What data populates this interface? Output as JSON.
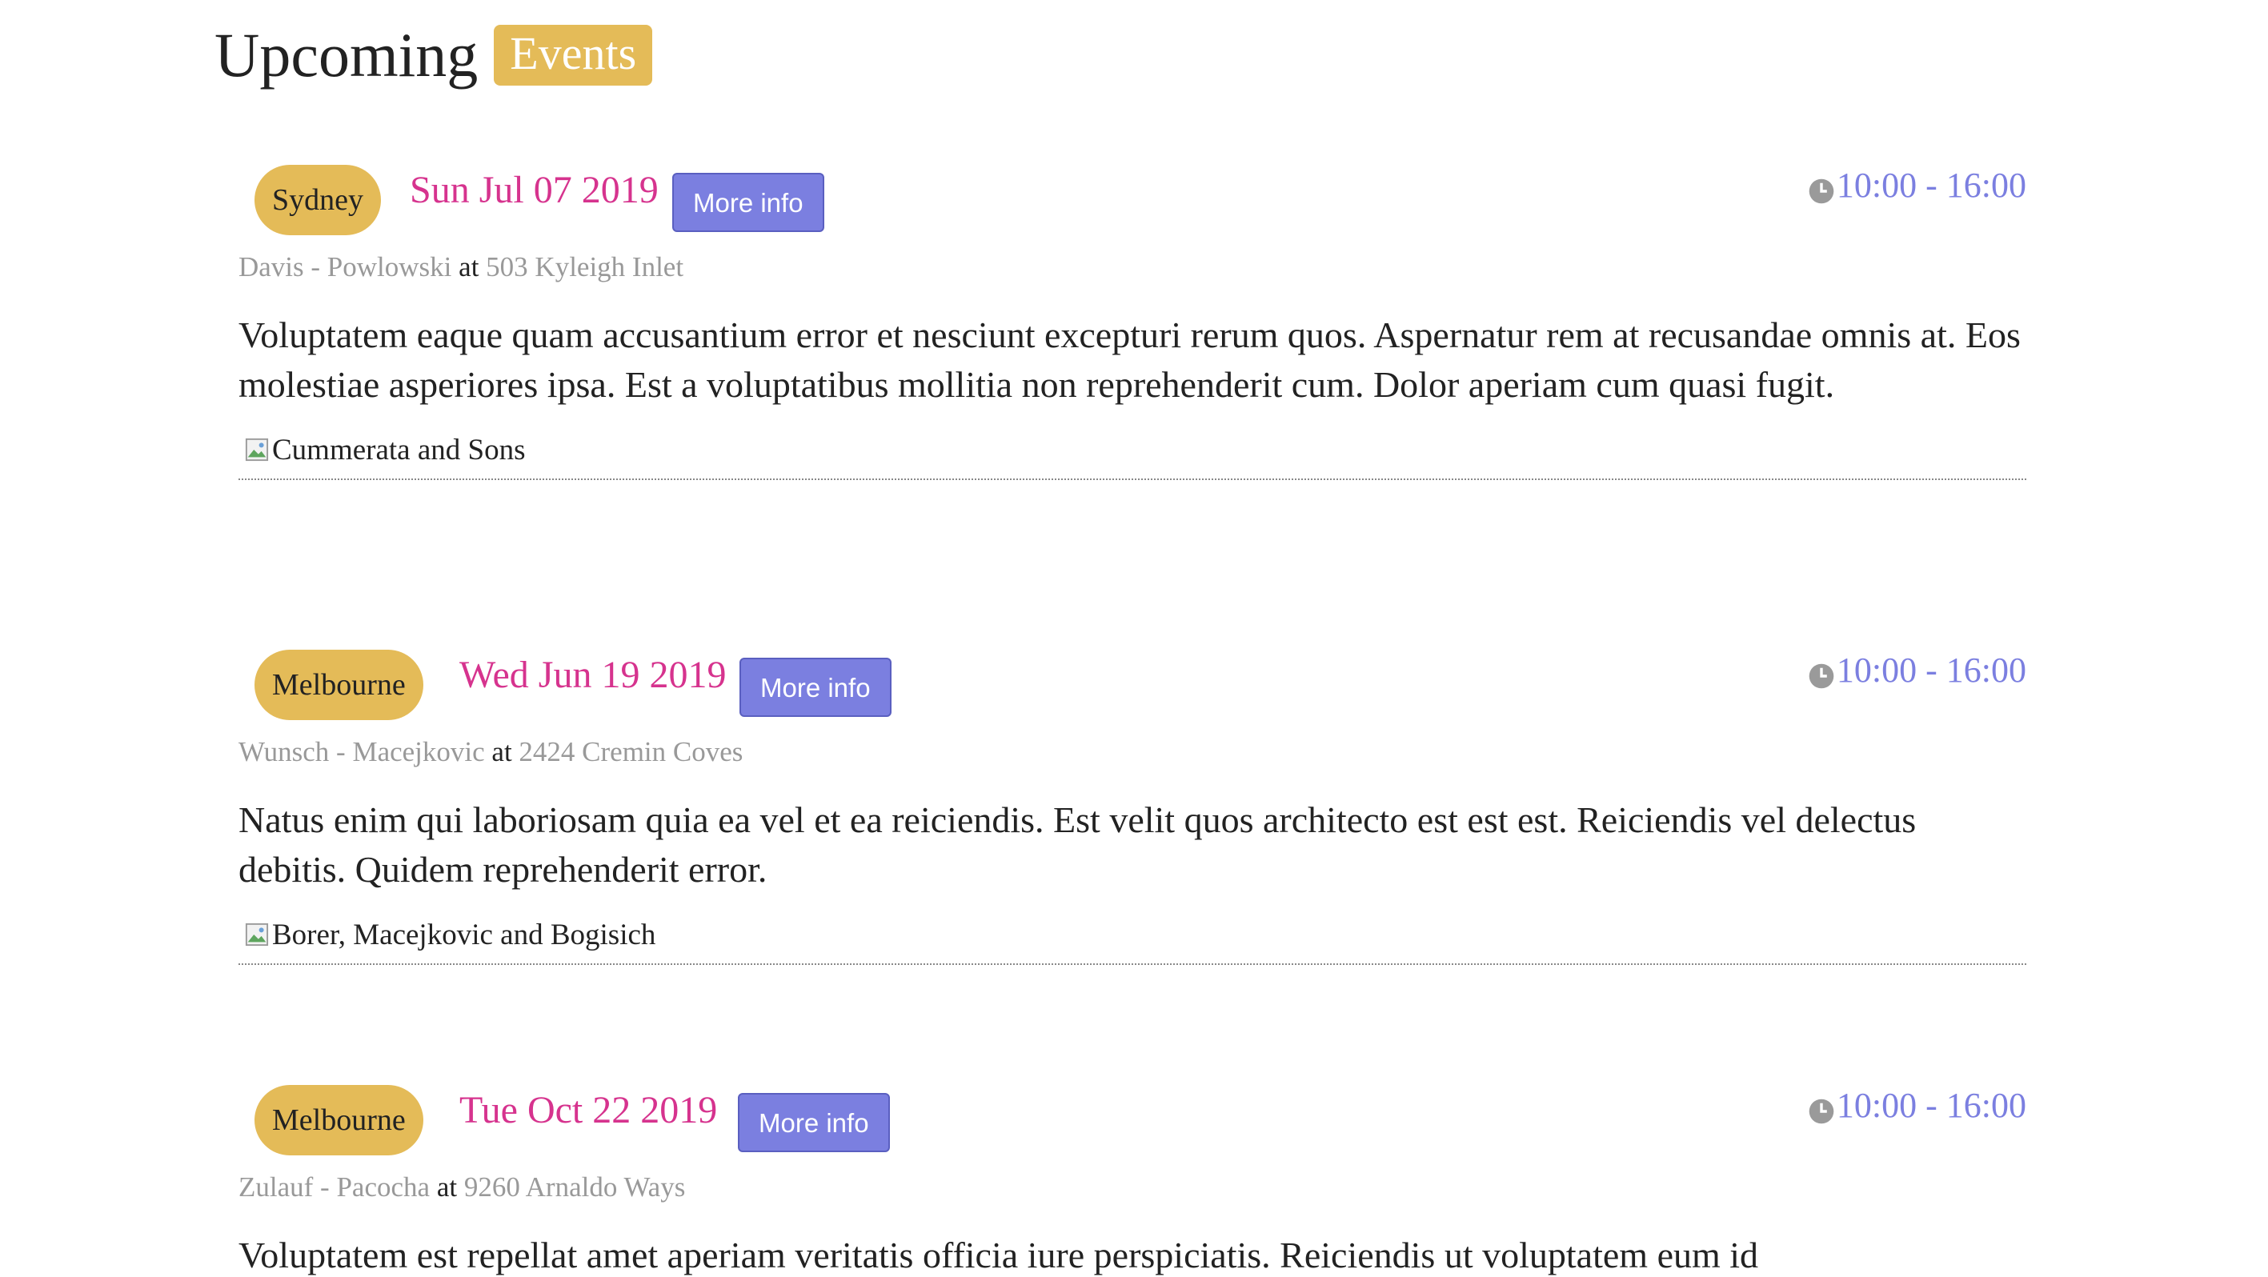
{
  "header": {
    "title": "Upcoming",
    "badge": "Events"
  },
  "events": [
    {
      "city": "Sydney",
      "date": "Sun Jul 07 2019",
      "more_info": "More info",
      "time": "10:00 - 16:00",
      "organizer": "Davis - Powlowski",
      "at": "at",
      "address": "503 Kyleigh Inlet",
      "description": "Voluptatem eaque quam accusantium error et nesciunt excepturi rerum quos. Aspernatur rem at recusandae omnis at. Eos molestiae asperiores ipsa. Est a voluptatibus mollitia non reprehenderit cum. Dolor aperiam cum quasi fugit.",
      "sponsor": "Cummerata and Sons"
    },
    {
      "city": "Melbourne",
      "date": "Wed Jun 19 2019",
      "more_info": "More info",
      "time": "10:00 - 16:00",
      "organizer": "Wunsch - Macejkovic",
      "at": "at",
      "address": "2424 Cremin Coves",
      "description": "Natus enim qui laboriosam quia ea vel et ea reiciendis. Est velit quos architecto est est est. Reiciendis vel delectus debitis. Quidem reprehenderit error.",
      "sponsor": "Borer, Macejkovic and Bogisich"
    },
    {
      "city": "Melbourne",
      "date": "Tue Oct 22 2019",
      "more_info": "More info",
      "time": "10:00 - 16:00",
      "organizer": "Zulauf - Pacocha",
      "at": "at",
      "address": "9260 Arnaldo Ways",
      "description": "Voluptatem est repellat amet aperiam veritatis officia iure perspiciatis. Reiciendis ut voluptatem eum id",
      "sponsor": ""
    }
  ],
  "colors": {
    "badge": "#e4bb58",
    "date": "#d6338e",
    "button": "#7b7fe0",
    "time": "#7b7fe0",
    "meta": "#999999"
  },
  "icons": {
    "time": "clock-icon",
    "sponsor_image": "broken-image-icon"
  }
}
